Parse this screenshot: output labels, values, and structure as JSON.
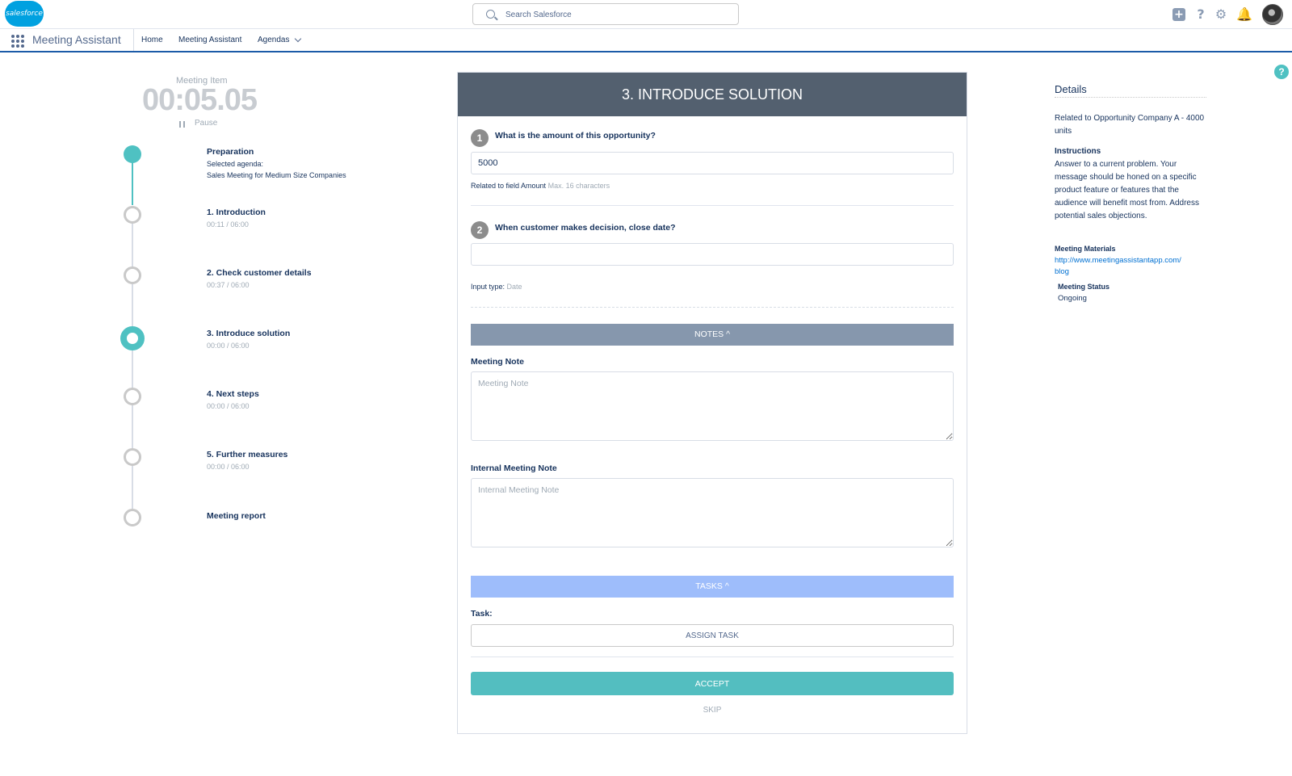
{
  "header": {
    "logo_text": "salesforce",
    "search_placeholder": "Search Salesforce",
    "icons": [
      "plus-icon",
      "help-icon",
      "gear-icon",
      "bell-icon",
      "avatar"
    ]
  },
  "nav": {
    "app_name": "Meeting Assistant",
    "items": [
      "Home",
      "Meeting Assistant",
      "Agendas"
    ]
  },
  "timer": {
    "label": "Meeting Item",
    "value": "00:05.05",
    "pause_label": "Pause"
  },
  "timeline": [
    {
      "title": "Preparation",
      "sub1": "Selected agenda:",
      "sub2": "Sales Meeting for Medium Size Companies",
      "state": "done"
    },
    {
      "title": "1. Introduction",
      "sub1": "00:11 / 06:00",
      "state": "todo"
    },
    {
      "title": "2. Check customer details",
      "sub1": "00:37 / 06:00",
      "state": "todo"
    },
    {
      "title": "3. Introduce solution",
      "sub1": "00:00 / 06:00",
      "state": "current"
    },
    {
      "title": "4. Next steps",
      "sub1": "00:00 / 06:00",
      "state": "todo"
    },
    {
      "title": "5. Further measures",
      "sub1": "00:00 / 06:00",
      "state": "todo"
    },
    {
      "title": "Meeting report",
      "state": "todo"
    }
  ],
  "card": {
    "title": "3. INTRODUCE SOLUTION",
    "q1": {
      "num": "1",
      "text": "What is the amount of this opportunity?",
      "value": "5000",
      "hint_label": "Related to field Amount",
      "hint_extra": "Max. 16 characters"
    },
    "q2": {
      "num": "2",
      "text": "When customer makes decision, close date?",
      "value": "",
      "hint_label": "Input type:",
      "hint_extra": "Date"
    },
    "notes_bar": "NOTES  ^",
    "meeting_note_label": "Meeting Note",
    "meeting_note_placeholder": "Meeting Note",
    "internal_note_label": "Internal Meeting Note",
    "internal_note_placeholder": "Internal Meeting Note",
    "tasks_bar": "TASKS  ^",
    "task_label": "Task:",
    "assign_label": "ASSIGN TASK",
    "accept_label": "ACCEPT",
    "skip_label": "SKIP"
  },
  "details": {
    "title": "Details",
    "related": "Related to Opportunity Company A - 4000 units",
    "instructions_head": "Instructions",
    "instructions": "Answer to a current problem. Your message should be honed on a specific product feature or features that the audience will benefit most from. Address potential sales objections.",
    "materials_head": "Meeting Materials",
    "materials_link": "http://www.meetingassistantapp.com/blog",
    "status_head": "Meeting Status",
    "status_value": "Ongoing"
  },
  "colors": {
    "accent": "#4fc1c2",
    "header": "#53606f",
    "notes": "#8697ad",
    "tasks": "#9ebdfb",
    "nav_border": "#1c5ba8"
  }
}
